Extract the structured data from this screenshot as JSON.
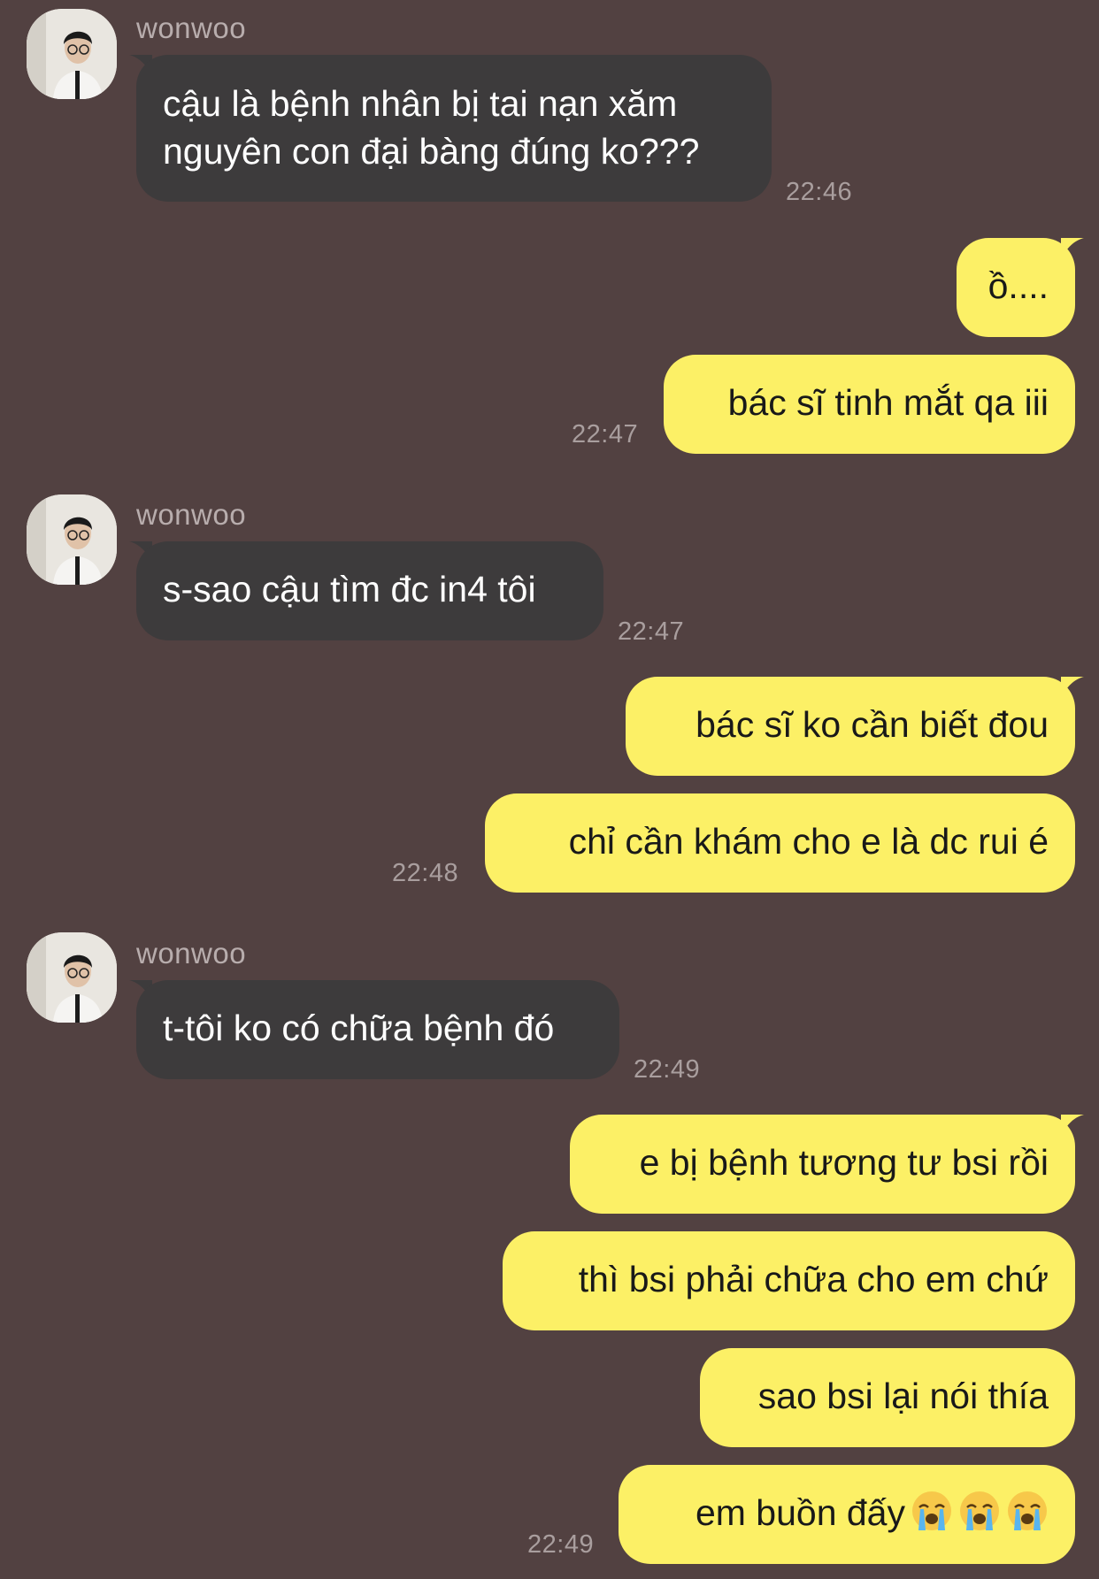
{
  "conversation": {
    "groups": [
      {
        "sender": "wonwoo",
        "messages": [
          "cậu là bệnh nhân bị tai nạn xăm\nnguyên con đại bàng đúng ko???"
        ],
        "time": "22:46"
      },
      {
        "sender": "me",
        "messages": [
          "ồ....",
          "bác sĩ tinh mắt qa iii"
        ],
        "time": "22:47"
      },
      {
        "sender": "wonwoo",
        "messages": [
          "s-sao cậu tìm đc in4 tôi"
        ],
        "time": "22:47"
      },
      {
        "sender": "me",
        "messages": [
          "bác sĩ ko cần biết đou",
          "chỉ cần khám cho e là dc rui é"
        ],
        "time": "22:48"
      },
      {
        "sender": "wonwoo",
        "messages": [
          "t-tôi ko có chữa bệnh đó"
        ],
        "time": "22:49"
      },
      {
        "sender": "me",
        "messages": [
          "e bị bệnh tương tư bsi rồi",
          "thì bsi phải chữa cho em chứ",
          "sao bsi lại nói thía",
          "em buồn đấy"
        ],
        "time": "22:49"
      }
    ],
    "emoji_suffix": [
      "loudly-crying-face",
      "loudly-crying-face",
      "loudly-crying-face"
    ]
  },
  "colors": {
    "background": "#524141",
    "incoming_bubble": "#3d3b3c",
    "outgoing_bubble": "#fcf066"
  }
}
